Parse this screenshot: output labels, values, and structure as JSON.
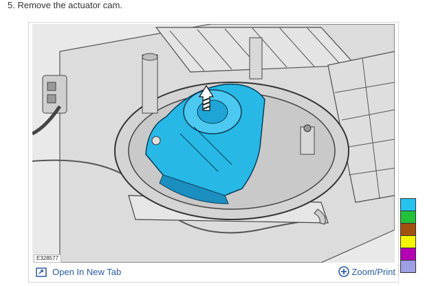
{
  "step": {
    "text": "5. Remove the actuator cam."
  },
  "figure": {
    "id_label": "E328577",
    "open_tab_label": "Open In New Tab",
    "zoom_label": "Zoom/Print"
  },
  "colors": {
    "link": "#2a5aa6",
    "highlight_part": "#27b8e6"
  },
  "icons": {
    "open_tab": "open-in-new-tab-icon",
    "zoom": "circle-plus-icon",
    "direction": "striped-arrow-icon"
  },
  "color_key": [
    {
      "color": "#27c3f0"
    },
    {
      "color": "#22c13a"
    },
    {
      "color": "#a0520f"
    },
    {
      "color": "#f5f500"
    },
    {
      "color": "#b400b4"
    },
    {
      "color": "#9f9fe6"
    }
  ]
}
